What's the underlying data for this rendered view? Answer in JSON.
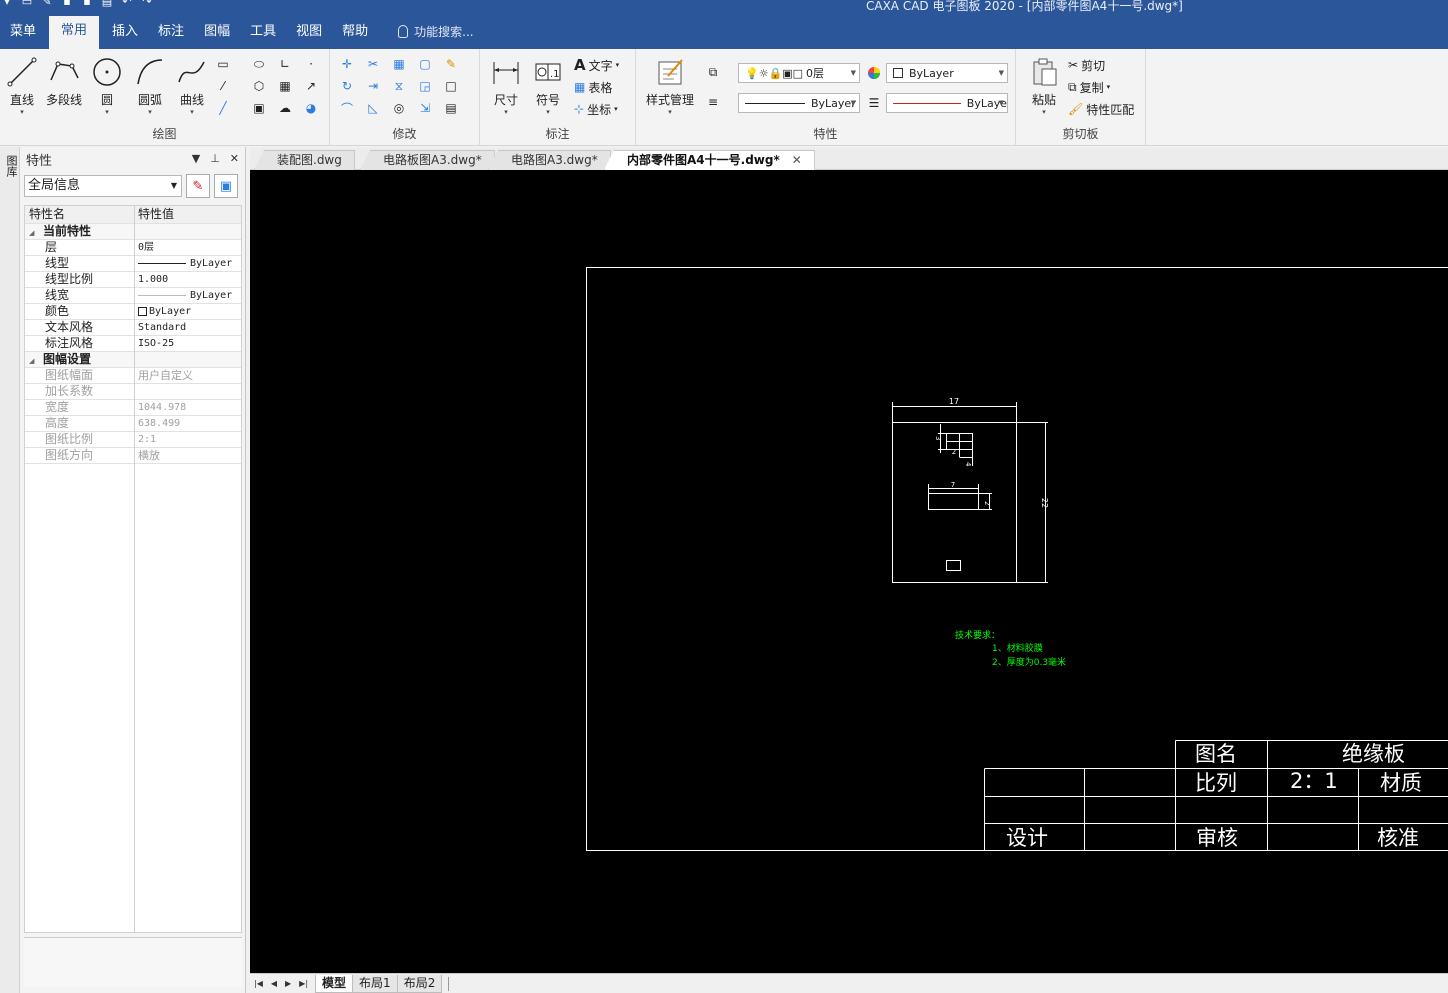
{
  "window": {
    "title": "CAXA CAD 电子图板 2020 - [内部零件图A4十一号.dwg*]"
  },
  "menu": {
    "items": [
      "菜单",
      "常用",
      "插入",
      "标注",
      "图幅",
      "工具",
      "视图",
      "帮助"
    ],
    "active_index": 1,
    "search_placeholder": "功能搜索..."
  },
  "ribbon": {
    "draw": {
      "label": "绘图",
      "line": "直线",
      "polyline": "多段线",
      "circle": "圆",
      "arc": "圆弧",
      "curve": "曲线"
    },
    "modify": {
      "label": "修改"
    },
    "dimension": {
      "label": "标注",
      "size": "尺寸",
      "symbol": "符号",
      "text": "文字",
      "table": "表格",
      "coord": "坐标"
    },
    "properties": {
      "label": "特性",
      "style_manager": "样式管理",
      "layer_value": "0层",
      "color_value": "ByLayer",
      "linetype_value": "ByLayer",
      "linewidth_value": "ByLaye"
    },
    "clipboard": {
      "label": "剪切板",
      "paste": "粘贴",
      "cut": "剪切",
      "copy": "复制",
      "match": "特性匹配"
    }
  },
  "panel": {
    "title": "特性",
    "side_tab": "图库",
    "selector": "全局信息",
    "col_name": "特性名",
    "col_value": "特性值",
    "sections": [
      {
        "title": "当前特性",
        "rows": [
          {
            "name": "层",
            "value": "0层",
            "grey": false
          },
          {
            "name": "线型",
            "value": "ByLayer",
            "grey": false
          },
          {
            "name": "线型比例",
            "value": "1.000",
            "grey": false
          },
          {
            "name": "线宽",
            "value": "ByLayer",
            "grey": false
          },
          {
            "name": "颜色",
            "value": "ByLayer",
            "grey": false
          },
          {
            "name": "文本风格",
            "value": "Standard",
            "grey": false
          },
          {
            "name": "标注风格",
            "value": "ISO-25",
            "grey": false
          }
        ]
      },
      {
        "title": "图幅设置",
        "rows": [
          {
            "name": "图纸幅面",
            "value": "用户自定义",
            "grey": true
          },
          {
            "name": "加长系数",
            "value": "",
            "grey": true
          },
          {
            "name": "宽度",
            "value": "1044.978",
            "grey": true
          },
          {
            "name": "高度",
            "value": "638.499",
            "grey": true
          },
          {
            "name": "图纸比例",
            "value": "2:1",
            "grey": true
          },
          {
            "name": "图纸方向",
            "value": "横放",
            "grey": true
          }
        ]
      }
    ]
  },
  "doc_tabs": [
    {
      "label": "装配图.dwg",
      "active": false
    },
    {
      "label": "电路板图A3.dwg*",
      "active": false
    },
    {
      "label": "电路图A3.dwg*",
      "active": false
    },
    {
      "label": "内部零件图A4十一号.dwg*",
      "active": true
    }
  ],
  "drawing": {
    "dims": {
      "top_width": "17",
      "inner_width": "7",
      "small_a": "3",
      "small_b": "2",
      "small_c": "4",
      "small_d": "2",
      "height": "22"
    },
    "tech": {
      "title": "技术要求：",
      "line1": "1、材料胶膜",
      "line2": "2、厚度为0.3毫米"
    },
    "titleblock": {
      "name_label": "图名",
      "name_value": "绝缘板",
      "scale_label": "比列",
      "scale_value": "2：1",
      "material_label": "材质",
      "design_label": "设计",
      "review_label": "审核",
      "approve_label": "核准"
    },
    "colors": {
      "background": "#000000",
      "lines": "#ffffff",
      "notes": "#00ff00"
    }
  },
  "layout_tabs": [
    {
      "label": "模型",
      "active": true
    },
    {
      "label": "布局1",
      "active": false
    },
    {
      "label": "布局2",
      "active": false
    }
  ]
}
